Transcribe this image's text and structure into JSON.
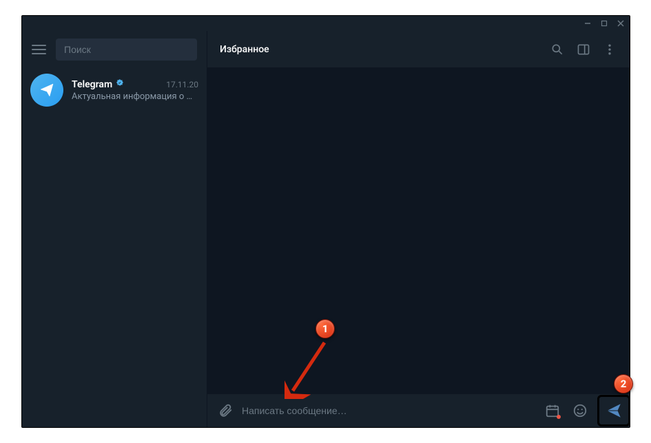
{
  "window": {
    "minimize": "—",
    "maximize": "□",
    "close": "✕"
  },
  "sidebar": {
    "search_placeholder": "Поиск",
    "chats": [
      {
        "name": "Telegram",
        "verified": true,
        "date": "17.11.20",
        "preview": "Актуальная информация о …"
      }
    ]
  },
  "chat": {
    "title": "Избранное",
    "composer_placeholder": "Написать сообщение…"
  },
  "callouts": {
    "one": "1",
    "two": "2"
  }
}
